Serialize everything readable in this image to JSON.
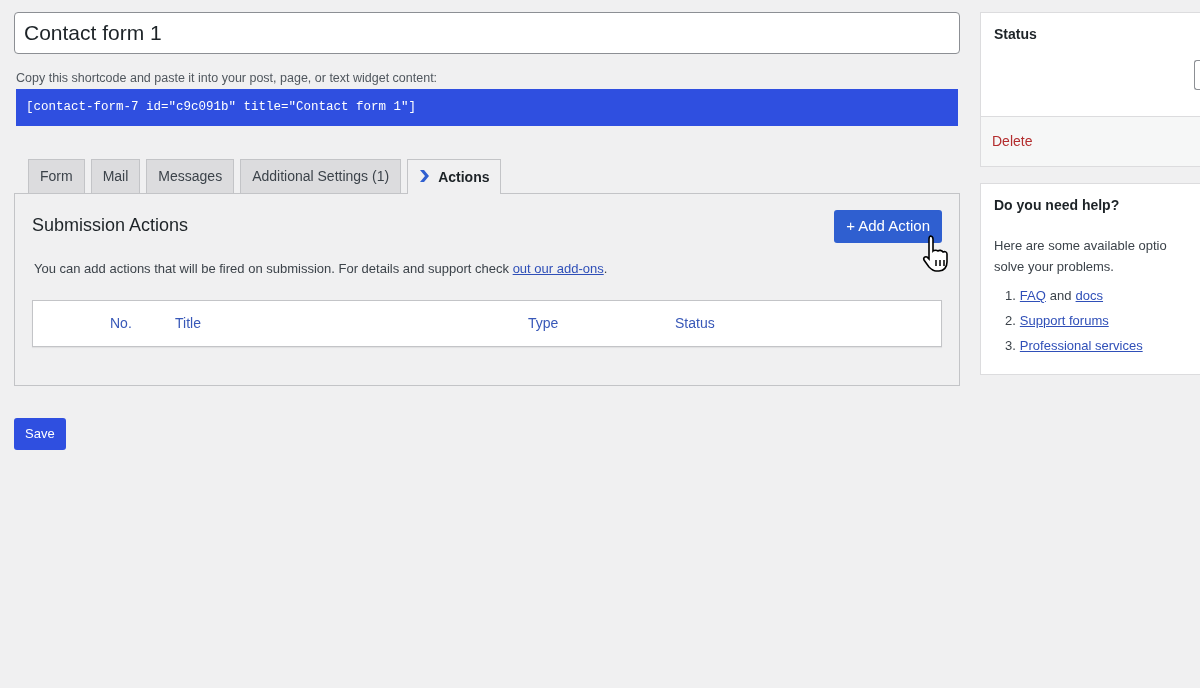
{
  "title_field": {
    "value": "Contact form 1"
  },
  "shortcode": {
    "label": "Copy this shortcode and paste it into your post, page, or text widget content:",
    "code": "[contact-form-7 id=\"c9c091b\" title=\"Contact form 1\"]"
  },
  "tabs": [
    {
      "label": "Form",
      "selected": false,
      "icon": false
    },
    {
      "label": "Mail",
      "selected": false,
      "icon": false
    },
    {
      "label": "Messages",
      "selected": false,
      "icon": false
    },
    {
      "label": "Additional Settings (1)",
      "selected": false,
      "icon": false
    },
    {
      "label": "Actions",
      "selected": true,
      "icon": true
    }
  ],
  "panel": {
    "heading": "Submission Actions",
    "add_button": "+ Add Action",
    "description": "You can add actions that will be fired on submission. For details and support check",
    "link": "out our add-ons",
    "after_link": ".",
    "table": {
      "columns": [
        "No.",
        "Title",
        "Type",
        "Status"
      ]
    }
  },
  "save_button": "Save",
  "sidebar": {
    "status": {
      "title": "Status",
      "delete": "Delete"
    },
    "help": {
      "title": "Do you need help?",
      "lines": [
        "Here are some available optio",
        "solve your problems."
      ],
      "items": [
        {
          "number": "1.",
          "parts": [
            {
              "text": "FAQ",
              "link": true
            },
            {
              "text": "and",
              "link": false
            },
            {
              "text": "docs",
              "link": true
            }
          ]
        },
        {
          "number": "2.",
          "parts": [
            {
              "text": "Support forums",
              "link": true
            }
          ]
        },
        {
          "number": "3.",
          "parts": [
            {
              "text": "Professional services",
              "link": true
            }
          ]
        }
      ]
    }
  }
}
